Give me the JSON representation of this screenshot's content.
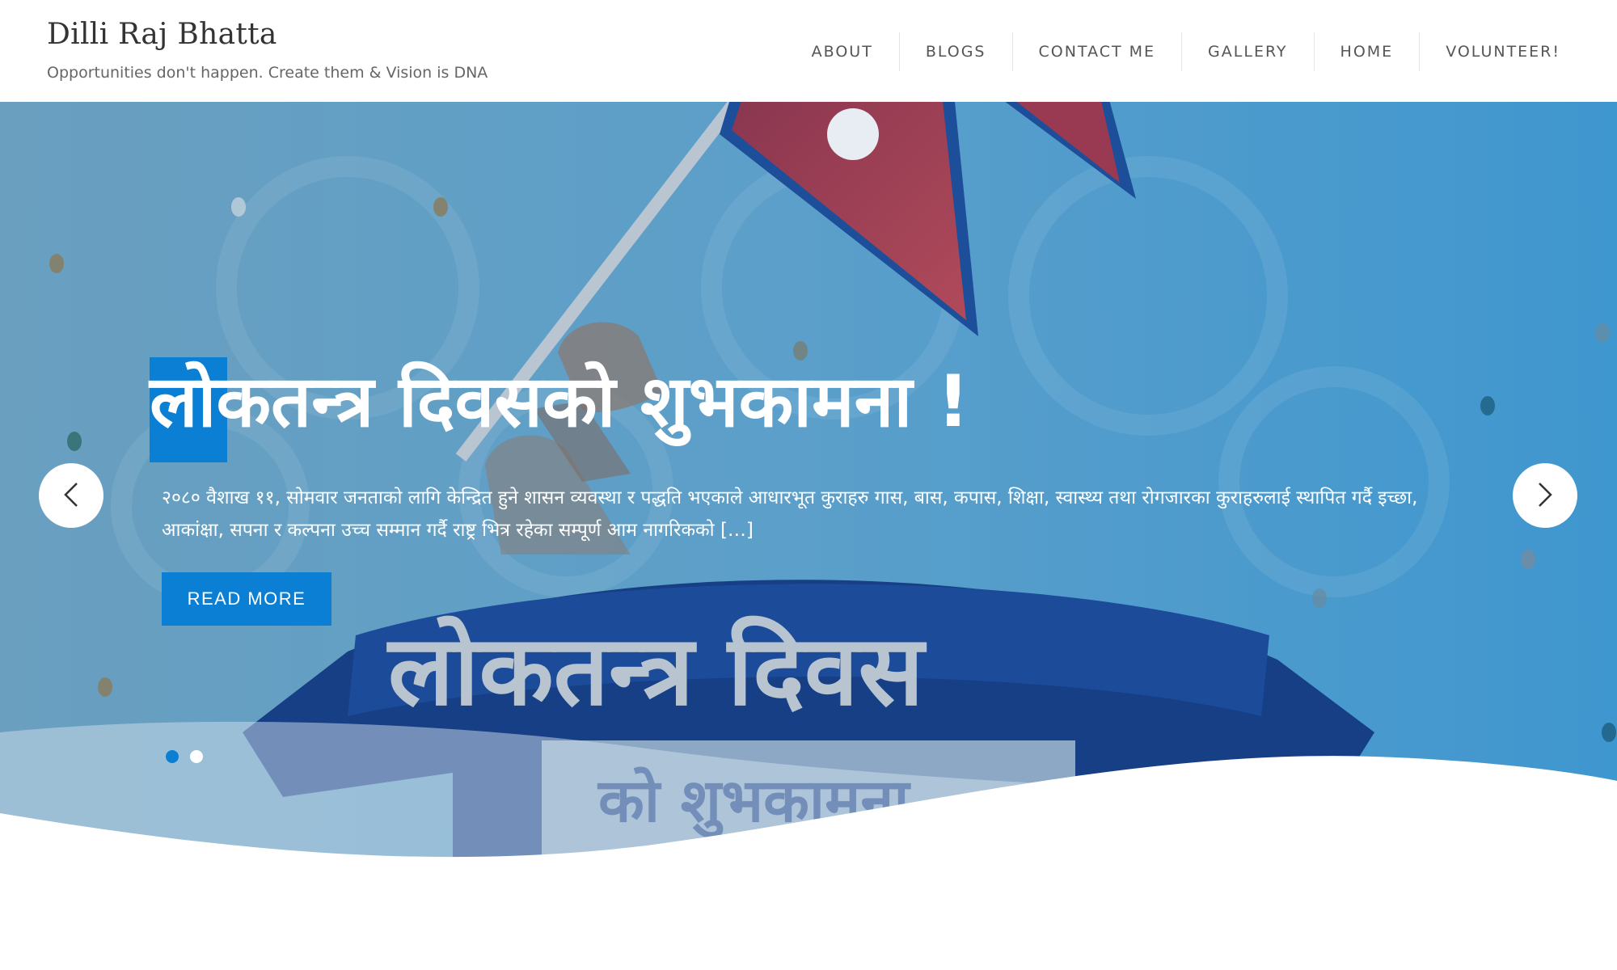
{
  "site": {
    "title": "Dilli Raj Bhatta",
    "tagline": "Opportunities don't happen. Create them & Vision is DNA"
  },
  "nav": {
    "items": [
      {
        "label": "ABOUT"
      },
      {
        "label": "BLOGS"
      },
      {
        "label": "CONTACT ME"
      },
      {
        "label": "GALLERY"
      },
      {
        "label": "HOME"
      },
      {
        "label": "VOLUNTEER!"
      }
    ]
  },
  "hero": {
    "slide_title": "लोकतन्त्र दिवसको शुभकामना !",
    "excerpt": "२०८० वैशाख ११, सोमवार   जनताको लागि केन्द्रित हुने शासन व्यवस्था र पद्धति भएकाले आधारभूत कुराहरु गास, बास, कपास, शिक्षा, स्वास्थ्य तथा रोगजारका कुराहरुलाई स्थापित गर्दै इच्छा, आकांक्षा, सपना र कल्पना उच्च सम्मान गर्दै राष्ट्र भित्र रहेका सम्पूर्ण आम नागरिकको […]",
    "read_more_label": "READ MORE",
    "banner_text_large": "लोकतन्त्र दिवस",
    "banner_text_small": "को शुभकामना",
    "slides_total": 2,
    "active_slide": 1
  },
  "icons": {
    "prev": "chevron-left-icon",
    "next": "chevron-right-icon"
  },
  "colors": {
    "accent": "#0a7fd4",
    "hero_bg": "#4a9ac9",
    "banner_blue": "#163f86",
    "flag_red": "#9b3a4a"
  }
}
